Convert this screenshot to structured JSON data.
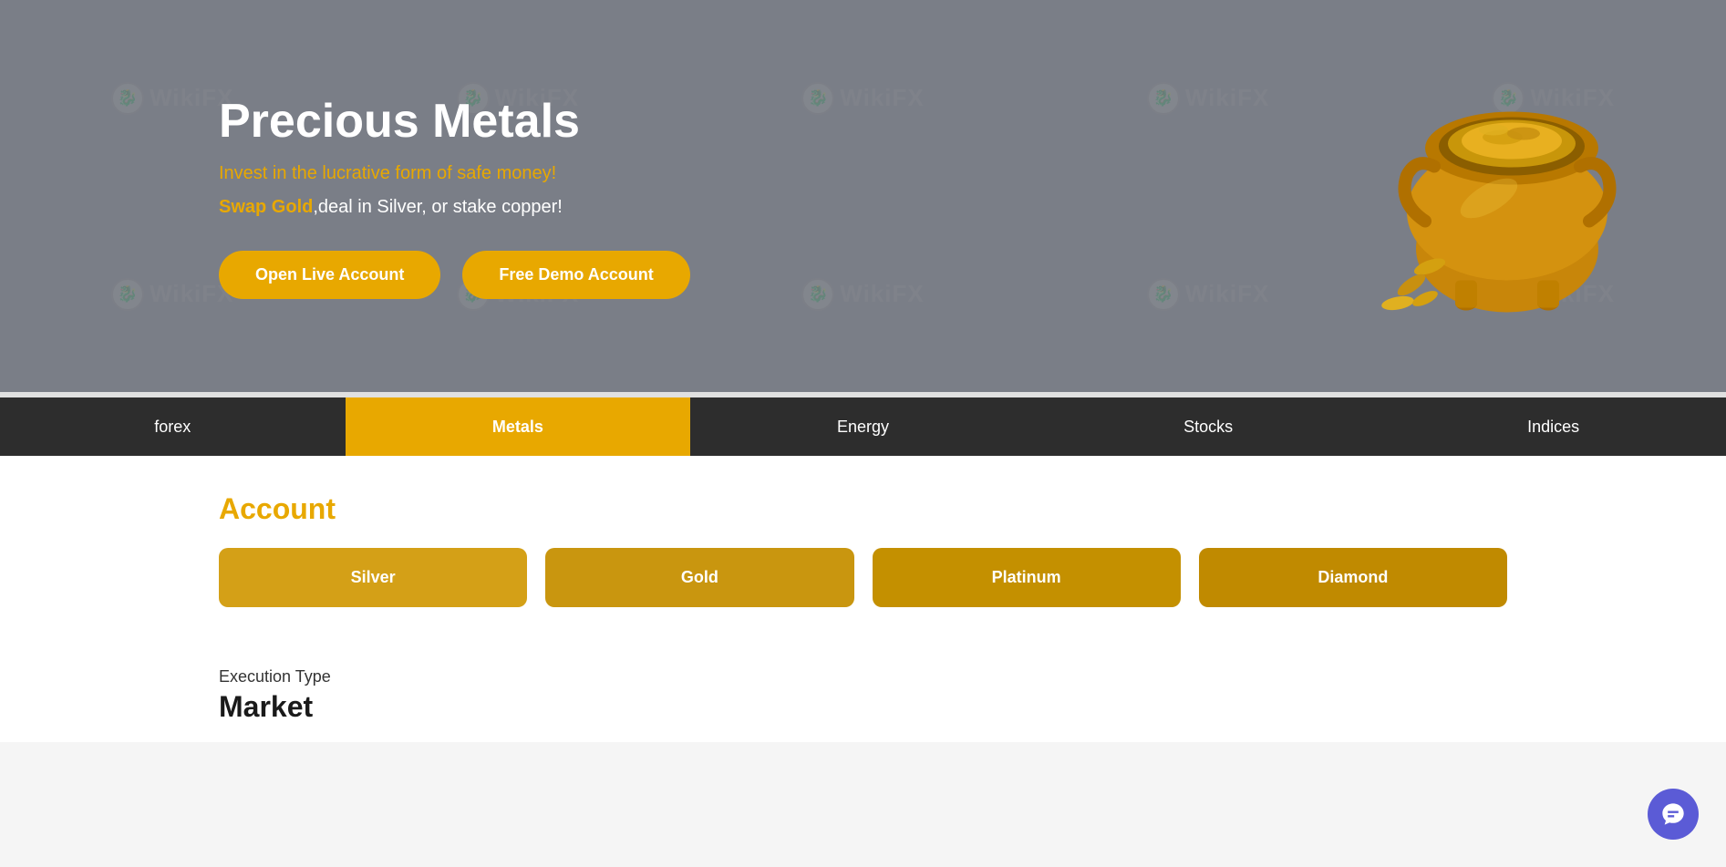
{
  "hero": {
    "title": "Precious Metals",
    "subtitle": "Invest in the lucrative form of safe money!",
    "desc_gold": "Swap Gold",
    "desc_rest": ",deal in Silver, or stake copper!",
    "btn_live": "Open Live Account",
    "btn_demo": "Free Demo Account"
  },
  "nav": {
    "tabs": [
      {
        "id": "forex",
        "label": "forex",
        "active": false
      },
      {
        "id": "metals",
        "label": "Metals",
        "active": true
      },
      {
        "id": "energy",
        "label": "Energy",
        "active": false
      },
      {
        "id": "stocks",
        "label": "Stocks",
        "active": false
      },
      {
        "id": "indices",
        "label": "Indices",
        "active": false
      }
    ]
  },
  "account": {
    "section_title": "Account",
    "types": [
      {
        "id": "silver",
        "label": "Silver"
      },
      {
        "id": "gold",
        "label": "Gold"
      },
      {
        "id": "platinum",
        "label": "Platinum"
      },
      {
        "id": "diamond",
        "label": "Diamond"
      }
    ]
  },
  "execution": {
    "label": "Execution Type",
    "value": "Market"
  },
  "chat": {
    "label": "Chat"
  },
  "watermarks": [
    "WikiFX",
    "WikiFX",
    "WikiFX",
    "WikiFX",
    "WikiFX",
    "WikiFX",
    "WikiFX",
    "WikiFX",
    "WikiFX",
    "WikiFX"
  ]
}
